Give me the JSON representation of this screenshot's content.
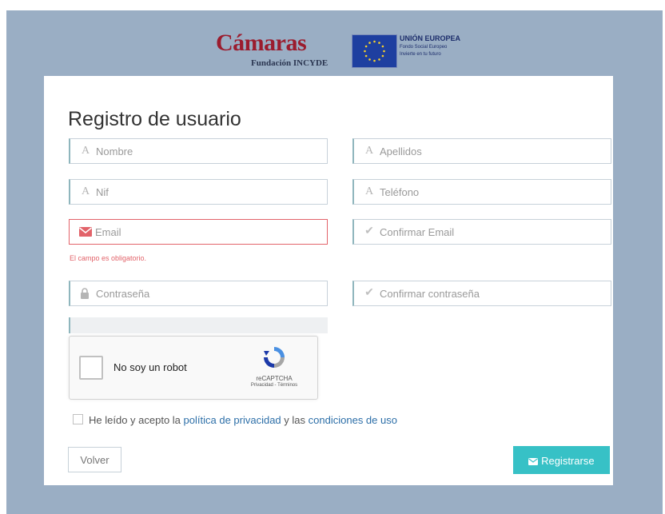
{
  "header": {
    "camaras_logo": "Cámaras",
    "camaras_sub": "Fundación INCYDE",
    "eu_title": "UNIÓN EUROPEA",
    "eu_line2": "Fondo Social Europeo",
    "eu_line3": "Invierte en tu futuro"
  },
  "form": {
    "title": "Registro de usuario",
    "fields": {
      "nombre": {
        "placeholder": "Nombre",
        "icon": "text-icon"
      },
      "apellidos": {
        "placeholder": "Apellidos",
        "icon": "text-icon"
      },
      "nif": {
        "placeholder": "Nif",
        "icon": "text-icon"
      },
      "telefono": {
        "placeholder": "Teléfono",
        "icon": "text-icon"
      },
      "email": {
        "placeholder": "Email",
        "icon": "envelope-icon"
      },
      "confirm_email": {
        "placeholder": "Confirmar Email",
        "icon": "check-icon"
      },
      "password": {
        "placeholder": "Contraseña",
        "icon": "lock-icon"
      },
      "confirm_password": {
        "placeholder": "Confirmar contraseña",
        "icon": "check-icon"
      }
    },
    "email_error": "El campo es obligatorio.",
    "captcha": {
      "label": "No soy un robot",
      "brand": "reCAPTCHA",
      "links": "Privacidad - Términos"
    },
    "terms": {
      "prefix": "He leído y acepto la",
      "privacy_link": "política de privacidad",
      "middle": "y las",
      "conditions_link": "condiciones de uso"
    },
    "buttons": {
      "back": "Volver",
      "register": "Registrarse"
    }
  },
  "colors": {
    "background": "#9aaec4",
    "accent": "#37c1c6",
    "error": "#e2636a",
    "link": "#2d6fa8"
  }
}
